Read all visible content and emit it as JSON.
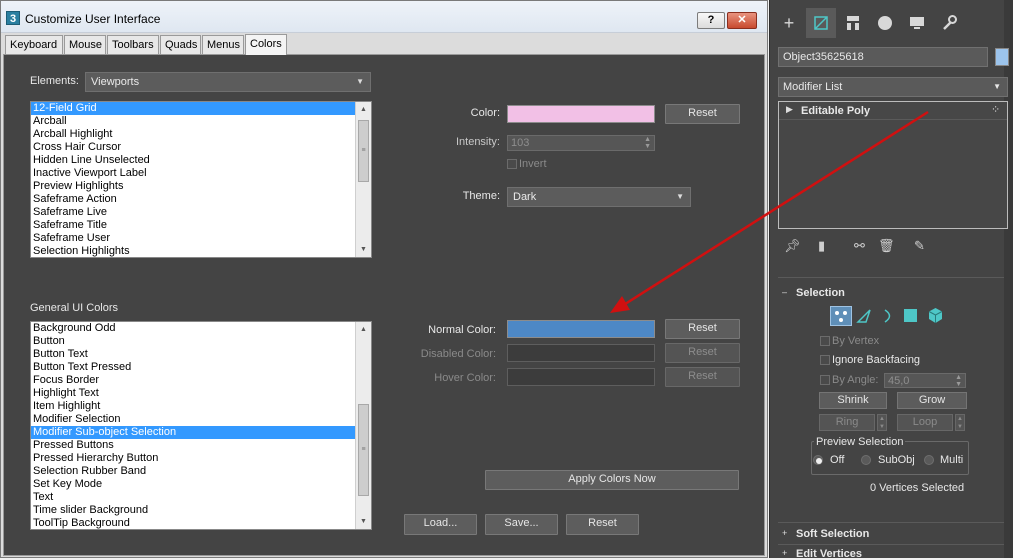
{
  "dialog": {
    "title": "Customize User Interface",
    "app_icon": "3",
    "help_label": "?",
    "close_label": "✕",
    "tabs": [
      {
        "label": "Keyboard"
      },
      {
        "label": "Mouse"
      },
      {
        "label": "Toolbars"
      },
      {
        "label": "Quads"
      },
      {
        "label": "Menus"
      },
      {
        "label": "Colors"
      }
    ],
    "active_tab": "Colors",
    "elements_label": "Elements:",
    "elements_value": "Viewports",
    "elements_list": [
      "12-Field Grid",
      "Arcball",
      "Arcball Highlight",
      "Cross Hair Cursor",
      "Hidden Line Unselected",
      "Inactive Viewport Label",
      "Preview Highlights",
      "Safeframe Action",
      "Safeframe Live",
      "Safeframe Title",
      "Safeframe User",
      "Selection Highlights"
    ],
    "elements_selected": "12-Field Grid",
    "color_label": "Color:",
    "color_value": "#f2c0e6",
    "reset_label": "Reset",
    "intensity_label": "Intensity:",
    "intensity_value": "103",
    "invert_label": "Invert",
    "theme_label": "Theme:",
    "theme_value": "Dark",
    "general_heading": "General UI Colors",
    "general_list": [
      "Background Odd",
      "Button",
      "Button Text",
      "Button Text Pressed",
      "Focus Border",
      "Highlight Text",
      "Item Highlight",
      "Modifier Selection",
      "Modifier Sub-object Selection",
      "Pressed Buttons",
      "Pressed Hierarchy Button",
      "Selection Rubber Band",
      "Set Key Mode",
      "Text",
      "Time slider Background",
      "ToolTip Background"
    ],
    "general_selected": "Modifier Sub-object Selection",
    "normal_color_label": "Normal Color:",
    "normal_color_value": "#4d88c6",
    "disabled_color_label": "Disabled Color:",
    "hover_color_label": "Hover Color:",
    "apply_label": "Apply Colors Now",
    "load_label": "Load...",
    "save_label": "Save...",
    "bottom_reset_label": "Reset"
  },
  "command_panel": {
    "tab_icons": [
      "plus-icon",
      "modify-icon",
      "hierarchy-icon",
      "motion-icon",
      "display-icon",
      "utilities-icon"
    ],
    "object_name": "Object35625618",
    "object_color": "#9cc4ec",
    "modifier_list": "Modifier List",
    "stack_item": "Editable Poly",
    "selection_rollout": "Selection",
    "by_vertex": "By Vertex",
    "ignore_backfacing": "Ignore Backfacing",
    "by_angle": "By Angle:",
    "angle_value": "45,0",
    "shrink": "Shrink",
    "grow": "Grow",
    "ring": "Ring",
    "loop": "Loop",
    "preview_selection": "Preview Selection",
    "radio_off": "Off",
    "radio_subobj": "SubObj",
    "radio_multi": "Multi",
    "vertices_selected": "0 Vertices Selected",
    "soft_selection": "Soft Selection",
    "edit_vertices": "Edit Vertices"
  },
  "colors": {
    "annotation_arrow": "#d01010",
    "list_highlight": "#3399ff"
  }
}
